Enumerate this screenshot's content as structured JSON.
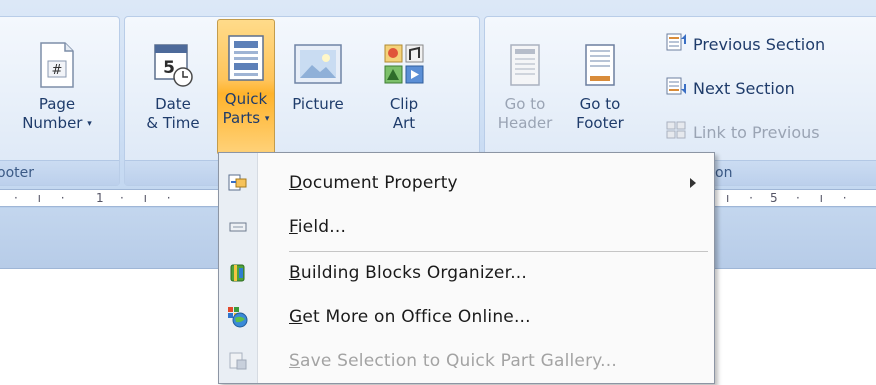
{
  "ribbon": {
    "groups": {
      "header_footer": {
        "label": "ooter"
      },
      "insert": {
        "label": ""
      },
      "navigation": {
        "label": "on"
      }
    },
    "buttons": {
      "page_number": {
        "line1": "Page",
        "line2": "Number",
        "arrow": "▾",
        "icon": "page-number-icon"
      },
      "date_time": {
        "line1": "Date",
        "line2": "& Time",
        "icon": "calendar-clock-icon",
        "day": "5"
      },
      "quick_parts": {
        "line1": "Quick",
        "line2": "Parts",
        "arrow": "▾",
        "icon": "quick-parts-icon"
      },
      "picture": {
        "line1": "Picture",
        "icon": "picture-icon"
      },
      "clip_art": {
        "line1": "Clip",
        "line2": "Art",
        "icon": "clip-art-icon"
      },
      "go_to_header": {
        "line1": "Go to",
        "line2": "Header",
        "icon": "go-to-header-icon"
      },
      "go_to_footer": {
        "line1": "Go to",
        "line2": "Footer",
        "icon": "go-to-footer-icon"
      },
      "previous_section": {
        "label": "Previous Section",
        "icon": "previous-section-icon"
      },
      "next_section": {
        "label": "Next Section",
        "icon": "next-section-icon"
      },
      "link_to_previous": {
        "label": "Link to Previous",
        "icon": "link-to-previous-icon"
      }
    }
  },
  "ruler": {
    "marks": [
      "1",
      "5"
    ]
  },
  "menu": {
    "items": [
      {
        "accel": "D",
        "rest": "ocument Property",
        "icon": "document-property-icon",
        "submenu": true,
        "enabled": true
      },
      {
        "accel": "F",
        "rest": "ield...",
        "icon": "field-icon",
        "submenu": false,
        "enabled": true
      },
      {
        "accel": "B",
        "rest": "uilding Blocks Organizer...",
        "icon": "building-blocks-icon",
        "submenu": false,
        "enabled": true
      },
      {
        "accel": "G",
        "rest": "et More on Office Online...",
        "icon": "office-online-icon",
        "submenu": false,
        "enabled": true
      },
      {
        "accel": "S",
        "rest": "ave Selection to Quick Part Gallery...",
        "icon": "save-selection-icon",
        "submenu": false,
        "enabled": false
      }
    ]
  },
  "colors": {
    "ribbon_blue": "#cfe0f5",
    "active_orange": "#ffc45a",
    "text_blue": "#1f3c6b",
    "disabled_gray": "#a3a3a3"
  }
}
